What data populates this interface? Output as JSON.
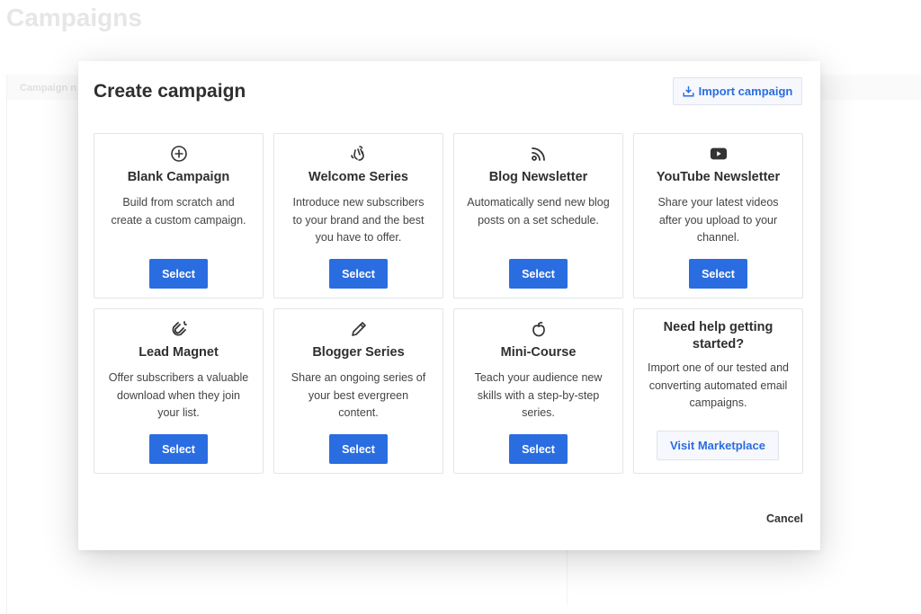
{
  "page": {
    "title": "Campaigns",
    "tab_partial": "Campaign n"
  },
  "modal": {
    "title": "Create campaign",
    "import_button": {
      "label": "Import campaign",
      "icon": "download-tray-icon"
    },
    "cards": [
      {
        "icon": "plus-circle-icon",
        "title": "Blank Campaign",
        "description": "Build from scratch and create a custom campaign.",
        "button": "Select"
      },
      {
        "icon": "waving-hand-icon",
        "title": "Welcome Series",
        "description": "Introduce new subscribers to your brand and the best you have to offer.",
        "button": "Select"
      },
      {
        "icon": "rss-icon",
        "title": "Blog Newsletter",
        "description": "Automatically send new blog posts on a set schedule.",
        "button": "Select"
      },
      {
        "icon": "youtube-icon",
        "title": "YouTube Newsletter",
        "description": "Share your latest videos after you upload to your channel.",
        "button": "Select"
      },
      {
        "icon": "magnet-icon",
        "title": "Lead Magnet",
        "description": "Offer subscribers a valuable download when they join your list.",
        "button": "Select"
      },
      {
        "icon": "pencil-icon",
        "title": "Blogger Series",
        "description": "Share an ongoing series of your best evergreen content.",
        "button": "Select"
      },
      {
        "icon": "apple-icon",
        "title": "Mini-Course",
        "description": "Teach your audience new skills with a step-by-step series.",
        "button": "Select"
      }
    ],
    "help_card": {
      "title": "Need help getting started?",
      "description": "Import one of our tested and converting automated email campaigns.",
      "button": "Visit Marketplace"
    },
    "cancel_label": "Cancel"
  },
  "colors": {
    "accent": "#2a6de0",
    "secondary_button_bg": "#f6f8fd",
    "card_border": "#e3e5ea"
  }
}
